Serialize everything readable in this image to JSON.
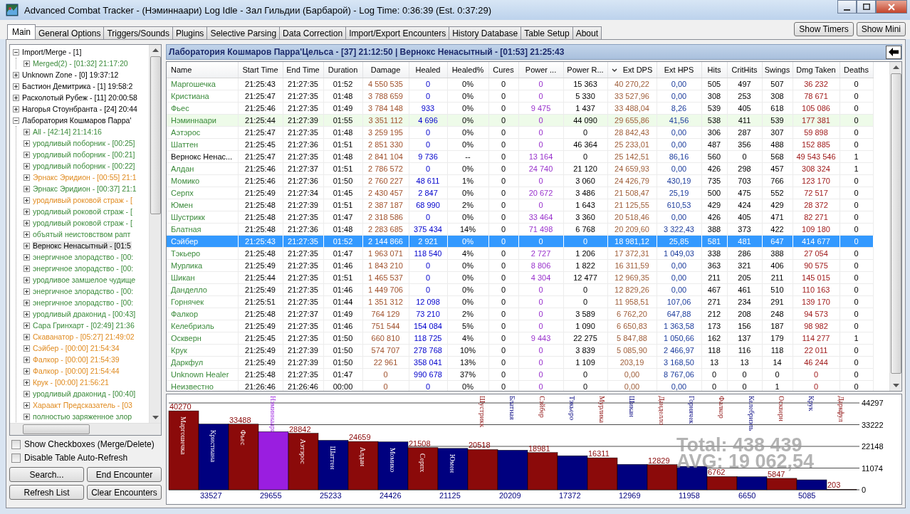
{
  "window": {
    "title": "Advanced Combat Tracker - (Нэминнаари) Log Idle - Зал Гильдии (Барбарой) - Log Time: 0:36:39 (Est. 0:37:29)"
  },
  "tabs": [
    {
      "label": "Main",
      "selected": true
    },
    {
      "label": "General Options",
      "selected": false
    },
    {
      "label": "Triggers/Sounds",
      "selected": false
    },
    {
      "label": "Plugins",
      "selected": false
    },
    {
      "label": "Selective Parsing",
      "selected": false
    },
    {
      "label": "Data Correction",
      "selected": false
    },
    {
      "label": "Import/Export Encounters",
      "selected": false
    },
    {
      "label": "History Database",
      "selected": false
    },
    {
      "label": "Table Setup",
      "selected": false
    },
    {
      "label": "About",
      "selected": false
    }
  ],
  "top_buttons": [
    "Show Timers",
    "Show Mini"
  ],
  "tree": {
    "items": [
      {
        "label": "Import/Merge - [1]",
        "kind": "zone",
        "selected": false,
        "expanded": true,
        "children": [
          {
            "label": "Merged(2) - [01:32] 21:17:20",
            "kind": "ally",
            "selected": false,
            "expanded": false
          }
        ]
      },
      {
        "label": "Unknown Zone - [0] 19:37:12",
        "kind": "zone",
        "selected": false,
        "expanded": false
      },
      {
        "label": "Бастион Демитрика - [1] 19:58:2",
        "kind": "zone",
        "selected": false,
        "expanded": false
      },
      {
        "label": "Расколотый Рубеж - [11] 20:00:58",
        "kind": "zone",
        "selected": false,
        "expanded": false
      },
      {
        "label": "Нагорья Стоунбранта - [24] 20:44",
        "kind": "zone",
        "selected": false,
        "expanded": false
      },
      {
        "label": "Лаборатория Кошмаров Парра'",
        "kind": "zone",
        "selected": false,
        "expanded": true,
        "children": [
          {
            "label": "All - [42:14] 21:14:16",
            "kind": "ally",
            "selected": false,
            "expanded": false
          },
          {
            "label": "уродливый поборник - [00:25]",
            "kind": "ally",
            "selected": false,
            "expanded": false
          },
          {
            "label": "уродливый поборник - [00:21]",
            "kind": "ally",
            "selected": false,
            "expanded": false
          },
          {
            "label": "уродливый поборник - [00:22]",
            "kind": "ally",
            "selected": false,
            "expanded": false
          },
          {
            "label": "Эрнакс Эридион - [00:55] 21:1",
            "kind": "other",
            "selected": false,
            "expanded": false
          },
          {
            "label": "Эрнакс Эридион - [00:37] 21:1",
            "kind": "ally",
            "selected": false,
            "expanded": false
          },
          {
            "label": "уродливый роковой страж - [",
            "kind": "other",
            "selected": false,
            "expanded": false
          },
          {
            "label": "уродливый роковой страж - [",
            "kind": "ally",
            "selected": false,
            "expanded": false
          },
          {
            "label": "уродливый роковой страж - [",
            "kind": "ally",
            "selected": false,
            "expanded": false
          },
          {
            "label": "объятый неистовством рапт",
            "kind": "ally",
            "selected": false,
            "expanded": false
          },
          {
            "label": "Вернокс Ненасытный - [01:5",
            "kind": "zone",
            "selected": true,
            "expanded": false
          },
          {
            "label": "энергичное злорадство - [00:",
            "kind": "ally",
            "selected": false,
            "expanded": false
          },
          {
            "label": "энергичное злорадство - [00:",
            "kind": "ally",
            "selected": false,
            "expanded": false
          },
          {
            "label": "уродливое замшелое чудище",
            "kind": "ally",
            "selected": false,
            "expanded": false
          },
          {
            "label": "энергичное злорадство - [00:",
            "kind": "ally",
            "selected": false,
            "expanded": false
          },
          {
            "label": "энергичное злорадство - [00:",
            "kind": "ally",
            "selected": false,
            "expanded": false
          },
          {
            "label": "уродливый драконид - [00:43]",
            "kind": "ally",
            "selected": false,
            "expanded": false
          },
          {
            "label": "Сара Гринхарт - [02:49] 21:36",
            "kind": "ally",
            "selected": false,
            "expanded": false
          },
          {
            "label": "Скаванатор - [05:27] 21:49:02",
            "kind": "other",
            "selected": false,
            "expanded": false
          },
          {
            "label": "Сэйбер - [00:00] 21:54:34",
            "kind": "other",
            "selected": false,
            "expanded": false
          },
          {
            "label": "Фалкор - [00:00] 21:54:39",
            "kind": "other",
            "selected": false,
            "expanded": false
          },
          {
            "label": "Фалкор - [00:00] 21:54:44",
            "kind": "other",
            "selected": false,
            "expanded": false
          },
          {
            "label": "Крук - [00:00] 21:56:21",
            "kind": "other",
            "selected": false,
            "expanded": false
          },
          {
            "label": "уродливый драконид - [00:40]",
            "kind": "ally",
            "selected": false,
            "expanded": false
          },
          {
            "label": "Хараакт Предсказатель - [03",
            "kind": "other",
            "selected": false,
            "expanded": false
          },
          {
            "label": "полностью заряженное злор",
            "kind": "ally",
            "selected": false,
            "expanded": false
          }
        ]
      }
    ]
  },
  "options": [
    {
      "label": "Show Checkboxes (Merge/Delete)",
      "checked": false
    },
    {
      "label": "Disable Table Auto-Refresh",
      "checked": false
    }
  ],
  "buttons": [
    "Search...",
    "End Encounter",
    "Refresh List",
    "Clear Encounters"
  ],
  "encounter_header": "Лаборатория Кошмаров Парра'Цельса - [37] 21:12:50 | Вернокс Ненасытный - [01:53] 21:25:43",
  "table": {
    "columns": [
      {
        "label": "Name",
        "kind": "name",
        "sorted": false
      },
      {
        "label": "Start Time",
        "kind": "plain",
        "sorted": false
      },
      {
        "label": "End Time",
        "kind": "plain",
        "sorted": false
      },
      {
        "label": "Duration",
        "kind": "plain",
        "sorted": false
      },
      {
        "label": "Damage",
        "kind": "damage",
        "sorted": false
      },
      {
        "label": "Healed",
        "kind": "healed",
        "sorted": false
      },
      {
        "label": "Healed%",
        "kind": "plain",
        "sorted": false
      },
      {
        "label": "Cures",
        "kind": "plain",
        "sorted": false
      },
      {
        "label": "Power ...",
        "kind": "power",
        "sorted": false
      },
      {
        "label": "Power R...",
        "kind": "plain",
        "sorted": false
      },
      {
        "label": "Ext DPS",
        "kind": "dps",
        "sorted": true
      },
      {
        "label": "Ext HPS",
        "kind": "hps",
        "sorted": false
      },
      {
        "label": "Hits",
        "kind": "plain",
        "sorted": false
      },
      {
        "label": "CritHits",
        "kind": "plain",
        "sorted": false
      },
      {
        "label": "Swings",
        "kind": "plain",
        "sorted": false
      },
      {
        "label": "Dmg Taken",
        "kind": "taken",
        "sorted": false
      },
      {
        "label": "Deaths",
        "kind": "plain",
        "sorted": false
      }
    ],
    "rows": [
      {
        "kind": "ally",
        "selected": false,
        "highlighted": false,
        "cells": [
          "Маргошечка",
          "21:25:43",
          "21:27:35",
          "01:52",
          "4 550 535",
          "0",
          "0%",
          "0",
          "0",
          "15 363",
          "40 270,22",
          "0,00",
          "505",
          "497",
          "507",
          "36 232",
          "0"
        ]
      },
      {
        "kind": "ally",
        "selected": false,
        "highlighted": false,
        "cells": [
          "Кристиана",
          "21:25:47",
          "21:27:35",
          "01:48",
          "3 788 659",
          "0",
          "0%",
          "0",
          "0",
          "5 330",
          "33 527,96",
          "0,00",
          "308",
          "253",
          "308",
          "78 671",
          "0"
        ]
      },
      {
        "kind": "ally",
        "selected": false,
        "highlighted": false,
        "cells": [
          "Фьес",
          "21:25:46",
          "21:27:35",
          "01:49",
          "3 784 148",
          "933",
          "0%",
          "0",
          "9 475",
          "1 437",
          "33 488,04",
          "8,26",
          "539",
          "405",
          "618",
          "105 086",
          "0"
        ]
      },
      {
        "kind": "ally",
        "selected": false,
        "highlighted": true,
        "cells": [
          "Нэминнаари",
          "21:25:44",
          "21:27:39",
          "01:55",
          "3 351 112",
          "4 696",
          "0%",
          "0",
          "0",
          "44 090",
          "29 655,86",
          "41,56",
          "538",
          "411",
          "539",
          "177 381",
          "0"
        ]
      },
      {
        "kind": "ally",
        "selected": false,
        "highlighted": false,
        "cells": [
          "Аэтэрос",
          "21:25:47",
          "21:27:35",
          "01:48",
          "3 259 195",
          "0",
          "0%",
          "0",
          "0",
          "0",
          "28 842,43",
          "0,00",
          "306",
          "287",
          "307",
          "59 898",
          "0"
        ]
      },
      {
        "kind": "ally",
        "selected": false,
        "highlighted": false,
        "cells": [
          "Шаттен",
          "21:25:45",
          "21:27:36",
          "01:51",
          "2 851 330",
          "0",
          "0%",
          "0",
          "0",
          "46 364",
          "25 233,01",
          "0,00",
          "487",
          "356",
          "488",
          "152 885",
          "0"
        ]
      },
      {
        "kind": "enemy",
        "selected": false,
        "highlighted": false,
        "cells": [
          "Вернокс Ненас...",
          "21:25:47",
          "21:27:35",
          "01:48",
          "2 841 104",
          "9 736",
          "--",
          "0",
          "13 164",
          "0",
          "25 142,51",
          "86,16",
          "560",
          "0",
          "568",
          "49 543 546",
          "1"
        ]
      },
      {
        "kind": "ally",
        "selected": false,
        "highlighted": false,
        "cells": [
          "Алдан",
          "21:25:46",
          "21:27:37",
          "01:51",
          "2 786 572",
          "0",
          "0%",
          "0",
          "24 740",
          "21 120",
          "24 659,93",
          "0,00",
          "426",
          "298",
          "457",
          "308 324",
          "1"
        ]
      },
      {
        "kind": "ally",
        "selected": false,
        "highlighted": false,
        "cells": [
          "Момико",
          "21:25:46",
          "21:27:36",
          "01:50",
          "2 760 227",
          "48 611",
          "1%",
          "0",
          "0",
          "3 060",
          "24 426,79",
          "430,19",
          "735",
          "703",
          "766",
          "123 170",
          "0"
        ]
      },
      {
        "kind": "ally",
        "selected": false,
        "highlighted": false,
        "cells": [
          "Серпх",
          "21:25:49",
          "21:27:34",
          "01:45",
          "2 430 457",
          "2 847",
          "0%",
          "0",
          "20 672",
          "3 486",
          "21 508,47",
          "25,19",
          "500",
          "475",
          "552",
          "72 517",
          "0"
        ]
      },
      {
        "kind": "ally",
        "selected": false,
        "highlighted": false,
        "cells": [
          "Юмен",
          "21:25:48",
          "21:27:39",
          "01:51",
          "2 387 187",
          "68 990",
          "2%",
          "0",
          "0",
          "1 643",
          "21 125,55",
          "610,53",
          "429",
          "424",
          "429",
          "28 372",
          "0"
        ]
      },
      {
        "kind": "ally",
        "selected": false,
        "highlighted": false,
        "cells": [
          "Шустрикк",
          "21:25:48",
          "21:27:35",
          "01:47",
          "2 318 586",
          "0",
          "0%",
          "0",
          "33 464",
          "3 360",
          "20 518,46",
          "0,00",
          "426",
          "405",
          "471",
          "82 271",
          "0"
        ]
      },
      {
        "kind": "ally",
        "selected": false,
        "highlighted": false,
        "cells": [
          "Блатная",
          "21:25:48",
          "21:27:36",
          "01:48",
          "2 283 685",
          "375 434",
          "14%",
          "0",
          "71 498",
          "6 768",
          "20 209,60",
          "3 322,43",
          "388",
          "373",
          "422",
          "109 180",
          "0"
        ]
      },
      {
        "kind": "ally",
        "selected": true,
        "highlighted": false,
        "cells": [
          "Сэйбер",
          "21:25:43",
          "21:27:35",
          "01:52",
          "2 144 866",
          "2 921",
          "0%",
          "0",
          "0",
          "0",
          "18 981,12",
          "25,85",
          "581",
          "481",
          "647",
          "414 677",
          "0"
        ]
      },
      {
        "kind": "ally",
        "selected": false,
        "highlighted": false,
        "cells": [
          "Тэкьеро",
          "21:25:48",
          "21:27:35",
          "01:47",
          "1 963 071",
          "118 540",
          "4%",
          "0",
          "2 727",
          "1 206",
          "17 372,31",
          "1 049,03",
          "338",
          "286",
          "388",
          "27 054",
          "0"
        ]
      },
      {
        "kind": "ally",
        "selected": false,
        "highlighted": false,
        "cells": [
          "Мурлика",
          "21:25:49",
          "21:27:35",
          "01:46",
          "1 843 210",
          "0",
          "0%",
          "0",
          "8 806",
          "1 822",
          "16 311,59",
          "0,00",
          "363",
          "321",
          "406",
          "90 575",
          "0"
        ]
      },
      {
        "kind": "ally",
        "selected": false,
        "highlighted": false,
        "cells": [
          "Шикан",
          "21:25:44",
          "21:27:35",
          "01:51",
          "1 465 537",
          "0",
          "0%",
          "0",
          "4 304",
          "12 477",
          "12 969,35",
          "0,00",
          "211",
          "205",
          "211",
          "145 015",
          "0"
        ]
      },
      {
        "kind": "ally",
        "selected": false,
        "highlighted": false,
        "cells": [
          "Данделло",
          "21:25:49",
          "21:27:35",
          "01:46",
          "1 449 706",
          "0",
          "0%",
          "0",
          "0",
          "0",
          "12 829,26",
          "0,00",
          "467",
          "461",
          "510",
          "110 163",
          "0"
        ]
      },
      {
        "kind": "ally",
        "selected": false,
        "highlighted": false,
        "cells": [
          "Горнячек",
          "21:25:51",
          "21:27:35",
          "01:44",
          "1 351 312",
          "12 098",
          "0%",
          "0",
          "0",
          "0",
          "11 958,51",
          "107,06",
          "271",
          "234",
          "291",
          "139 170",
          "0"
        ]
      },
      {
        "kind": "ally",
        "selected": false,
        "highlighted": false,
        "cells": [
          "Фалкор",
          "21:25:48",
          "21:27:37",
          "01:49",
          "764 129",
          "73 210",
          "2%",
          "0",
          "0",
          "3 589",
          "6 762,20",
          "647,88",
          "212",
          "208",
          "248",
          "94 573",
          "0"
        ]
      },
      {
        "kind": "ally",
        "selected": false,
        "highlighted": false,
        "cells": [
          "Келебриэль",
          "21:25:49",
          "21:27:35",
          "01:46",
          "751 544",
          "154 084",
          "5%",
          "0",
          "0",
          "1 090",
          "6 650,83",
          "1 363,58",
          "173",
          "156",
          "187",
          "98 982",
          "0"
        ]
      },
      {
        "kind": "ally",
        "selected": false,
        "highlighted": false,
        "cells": [
          "Оскверн",
          "21:25:45",
          "21:27:35",
          "01:50",
          "660 810",
          "118 725",
          "4%",
          "0",
          "9 443",
          "22 275",
          "5 847,88",
          "1 050,66",
          "162",
          "137",
          "179",
          "114 277",
          "1"
        ]
      },
      {
        "kind": "ally",
        "selected": false,
        "highlighted": false,
        "cells": [
          "Крук",
          "21:25:49",
          "21:27:39",
          "01:50",
          "574 707",
          "278 768",
          "10%",
          "0",
          "0",
          "3 839",
          "5 085,90",
          "2 466,97",
          "118",
          "116",
          "118",
          "22 011",
          "0"
        ]
      },
      {
        "kind": "ally",
        "selected": false,
        "highlighted": false,
        "cells": [
          "Даркфул",
          "21:25:49",
          "21:27:39",
          "01:50",
          "22 961",
          "358 041",
          "13%",
          "0",
          "0",
          "1 109",
          "203,19",
          "3 168,50",
          "13",
          "13",
          "14",
          "46 244",
          "0"
        ]
      },
      {
        "kind": "ally",
        "selected": false,
        "highlighted": false,
        "cells": [
          "Unknown Healer",
          "21:25:48",
          "21:27:35",
          "01:47",
          "0",
          "990 678",
          "37%",
          "0",
          "0",
          "0",
          "0,00",
          "8 767,06",
          "0",
          "0",
          "0",
          "0",
          "0"
        ]
      },
      {
        "kind": "ally",
        "selected": false,
        "highlighted": false,
        "cells": [
          "Неизвестно",
          "21:26:46",
          "21:26:46",
          "00:00",
          "0",
          "0",
          "0%",
          "0",
          "0",
          "0",
          "0,00",
          "0,00",
          "0",
          "0",
          "1",
          "0",
          "0"
        ]
      }
    ]
  },
  "chart": {
    "total": "Total: 438 439",
    "average": "AVG: 19 062,54",
    "chart_data": {
      "type": "bar",
      "categories": [
        "Маргошечка",
        "Кристиана",
        "Фьес",
        "Нэминнаари",
        "Аэтэрос",
        "Шаттен",
        "Алдан",
        "Момико",
        "Серпх",
        "Юмен",
        "Шустрикк",
        "Блатная",
        "Сэйбер",
        "Тэкьеро",
        "Мурлика",
        "Шикан",
        "Данделло",
        "Горнячек",
        "Фалкор",
        "Келебриэль",
        "Оскверн",
        "Крук",
        "Даркфул"
      ],
      "series": [
        {
          "color": "#8b0a0a",
          "values": [
            40270,
            null,
            33488,
            null,
            28842,
            null,
            24659,
            null,
            21508,
            null,
            20518,
            null,
            18981,
            null,
            16311,
            null,
            12829,
            null,
            6762,
            null,
            5847,
            null,
            203
          ]
        },
        {
          "color": "#00007f",
          "values": [
            null,
            33527,
            null,
            null,
            null,
            25233,
            null,
            24426,
            null,
            21125,
            null,
            20209,
            null,
            17372,
            null,
            12969,
            null,
            11958,
            null,
            6650,
            null,
            5085,
            null
          ]
        },
        {
          "color": "#9a1ee0",
          "values": [
            null,
            null,
            null,
            29655,
            null,
            null,
            null,
            null,
            null,
            null,
            null,
            null,
            null,
            null,
            null,
            null,
            null,
            null,
            null,
            null,
            null,
            null,
            null
          ]
        }
      ],
      "ylim": [
        0,
        44297
      ],
      "yticks": [
        0,
        11074,
        22148,
        33222,
        44297
      ],
      "grid": true,
      "data_labels": true
    }
  }
}
